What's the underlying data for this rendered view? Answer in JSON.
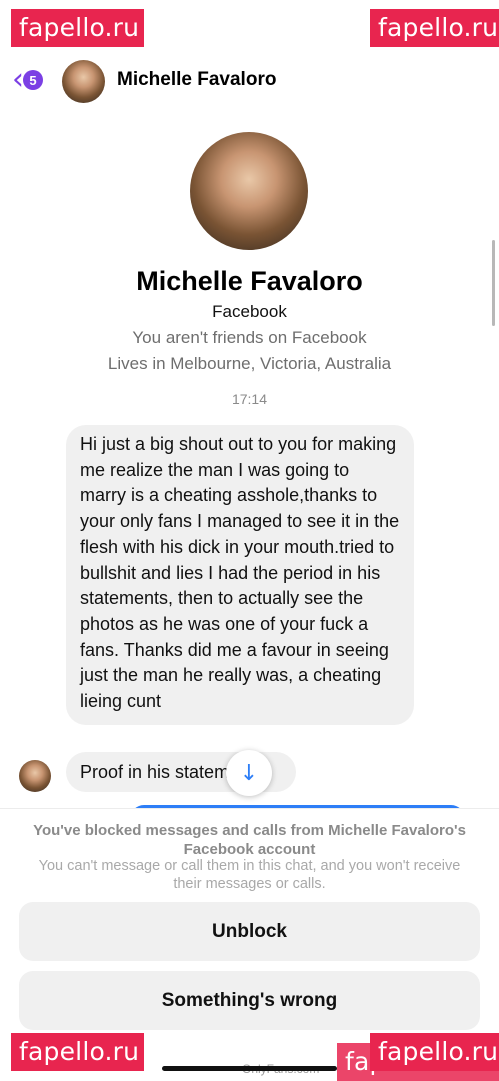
{
  "header": {
    "back_badge_count": "5",
    "contact_name": "Michelle Favaloro"
  },
  "profile": {
    "name": "Michelle Favaloro",
    "source": "Facebook",
    "friend_status": "You aren't friends on Facebook",
    "location": "Lives in Melbourne, Victoria, Australia"
  },
  "conversation": {
    "timestamp": "17:14",
    "messages": [
      {
        "text": "Hi just a big shout out to you for making me realize the man I was going to marry is a cheating asshole,thanks to your only fans I managed to see it in the flesh with his dick in your mouth.tried to bullshit and lies I had the period in his statements, then to actually see the photos as he was one of  your fuck a fans. Thanks did me a favour in seeing just the man he really was, a cheating lieing cunt"
      },
      {
        "text": "Proof in his statements"
      }
    ]
  },
  "blocked_panel": {
    "title": "You've blocked messages and calls from Michelle Favaloro's Facebook account",
    "subtitle": "You can't message or call them in this chat, and you won't receive their messages or calls.",
    "unblock_label": "Unblock",
    "something_wrong_label": "Something's wrong"
  },
  "watermarks": {
    "text": "fapello.ru",
    "bottom_text": "OnlyFans.com"
  },
  "colors": {
    "accent_purple": "#7b3fe4",
    "messenger_blue": "#2d7ef7",
    "watermark_pink": "#e8254f",
    "bubble_gray": "#f0f0f0"
  },
  "icons": {
    "back": "chevron-left-icon",
    "scroll_down": "arrow-down-icon"
  }
}
